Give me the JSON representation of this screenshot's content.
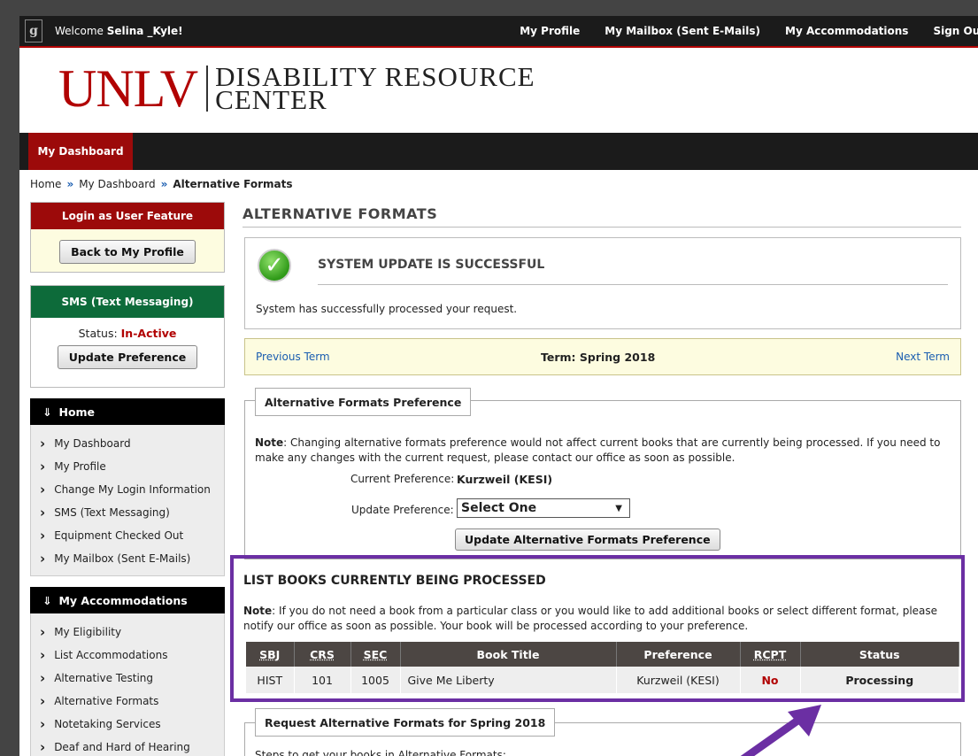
{
  "topbar": {
    "welcome_prefix": "Welcome ",
    "user": "Selina _Kyle!",
    "links": [
      "My Profile",
      "My Mailbox (Sent E-Mails)",
      "My Accommodations",
      "Sign Out"
    ]
  },
  "header": {
    "logo": "UNLV",
    "title_line1": "DISABILITY RESOURCE",
    "title_line2": "CENTER"
  },
  "nav": {
    "tab": "My Dashboard"
  },
  "breadcrumb": {
    "home": "Home",
    "dashboard": "My Dashboard",
    "current": "Alternative Formats"
  },
  "sidebar": {
    "login_box": {
      "title": "Login as User Feature",
      "button": "Back to My Profile"
    },
    "sms_box": {
      "title": "SMS (Text Messaging)",
      "status_label": "Status:",
      "status_value": "In-Active",
      "button": "Update Preference"
    },
    "home_section": {
      "title": "Home",
      "items": [
        "My Dashboard",
        "My Profile",
        "Change My Login Information",
        "SMS (Text Messaging)",
        "Equipment Checked Out",
        "My Mailbox (Sent E-Mails)"
      ]
    },
    "acc_section": {
      "title": "My Accommodations",
      "items": [
        "My Eligibility",
        "List Accommodations",
        "Alternative Testing",
        "Alternative Formats",
        "Notetaking Services",
        "Deaf and Hard of Hearing"
      ]
    }
  },
  "main": {
    "title": "ALTERNATIVE FORMATS",
    "success": {
      "heading": "SYSTEM UPDATE IS SUCCESSFUL",
      "message": "System has successfully processed your request."
    },
    "term": {
      "previous": "Previous Term",
      "current": "Term: Spring 2018",
      "next": "Next Term"
    },
    "pref": {
      "legend": "Alternative Formats Preference",
      "note_label": "Note",
      "note_text": ": Changing alternative formats preference would not affect current books that are currently being processed. If you need to make any changes with the current request, please contact our office as soon as possible.",
      "current_label": "Current Preference:",
      "current_value": "Kurzweil (KESI)",
      "update_label": "Update Preference:",
      "select_value": "Select One",
      "button": "Update Alternative Formats Preference"
    },
    "books": {
      "title": "LIST BOOKS CURRENTLY BEING PROCESSED",
      "note_label": "Note",
      "note_text": ": If you do not need a book from a particular class or you would like to add additional books or select different format, please notify our office as soon as possible. Your book will be processed according to your preference.",
      "columns": [
        "SBJ",
        "CRS",
        "SEC",
        "Book Title",
        "Preference",
        "RCPT",
        "Status"
      ],
      "rows": [
        [
          "HIST",
          "101",
          "1005",
          "Give Me Liberty",
          "Kurzweil (KESI)",
          "No",
          "Processing"
        ]
      ]
    },
    "request": {
      "legend": "Request Alternative Formats for Spring 2018",
      "intro": "Steps to get your books in Alternative Formats:"
    }
  },
  "colors": {
    "brand_red": "#b10202",
    "highlight": "#6b2fa3",
    "sms_green": "#0d6b3a"
  }
}
